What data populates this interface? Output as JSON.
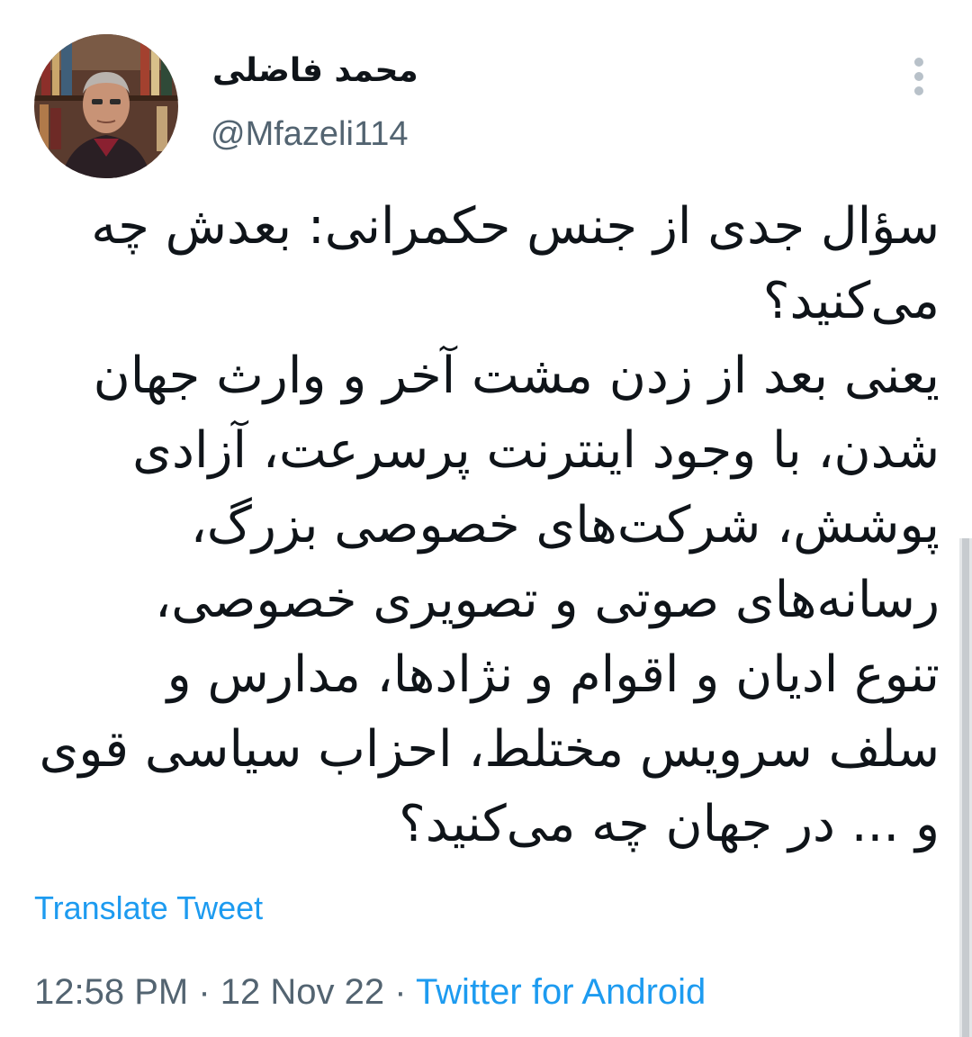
{
  "author": {
    "display_name": "محمد فاضلی",
    "handle": "@Mfazeli114",
    "avatar_icon": "profile-photo"
  },
  "more_icon": "more-vertical-icon",
  "tweet": {
    "lines": [
      "سؤال جدی از جنس حکمرانی: بعدش چه",
      "می‌کنید؟",
      "یعنی بعد از زدن مشت آخر و وارث جهان",
      "شدن، با وجود اینترنت پرسرعت، آزادی",
      "پوشش، شرکت‌های خصوصی بزرگ،",
      "رسانه‌های صوتی و تصویری خصوصی،",
      "تنوع ادیان و اقوام و نژادها، مدارس و",
      "سلف سرویس مختلط، احزاب سیاسی قوی",
      "و ... در جهان چه می‌کنید؟"
    ]
  },
  "translate_label": "Translate Tweet",
  "meta": {
    "time": "12:58 PM",
    "separator1": " · ",
    "date": "12 Nov 22",
    "separator2": " · ",
    "source": "Twitter for Android"
  },
  "colors": {
    "link": "#1d9bf0",
    "secondary_text": "#536471",
    "primary_text": "#0f1419"
  }
}
